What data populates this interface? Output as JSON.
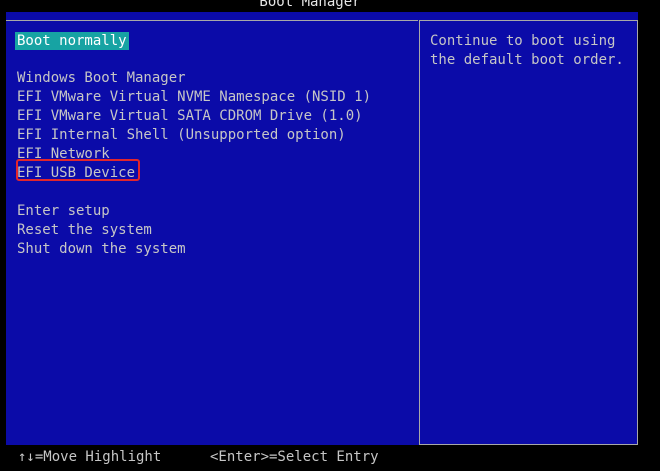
{
  "window": {
    "title": "Boot Manager"
  },
  "menu": {
    "selected": "Boot normally",
    "boot_entries": [
      "Windows Boot Manager",
      "EFI VMware Virtual NVME Namespace (NSID 1)",
      "EFI VMware Virtual SATA CDROM Drive (1.0)",
      "EFI Internal Shell (Unsupported option)",
      "EFI Network",
      "EFI USB Device"
    ],
    "actions": [
      "Enter setup",
      "Reset the system",
      "Shut down the system"
    ]
  },
  "help": {
    "text": "Continue to boot using the default boot order."
  },
  "statusbar": {
    "move_hint": "↑↓=Move Highlight",
    "select_hint": "<Enter>=Select Entry"
  },
  "colors": {
    "background": "#0b0ba8",
    "selected_bg": "#17a3a3",
    "text": "#c6c6c6",
    "highlight_border": "#e2262c"
  }
}
